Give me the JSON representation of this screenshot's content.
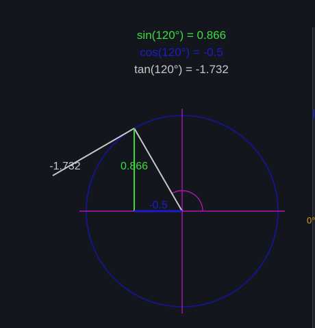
{
  "readouts": {
    "sin": "sin(120°) = 0.866",
    "cos": "cos(120°) = -0.5",
    "tan": "tan(120°) = -1.732"
  },
  "labels": {
    "sin_value": "0.866",
    "cos_value": "-0.5",
    "tan_value": "-1.732",
    "zero_angle": "0°"
  },
  "angle_deg": 120,
  "colors": {
    "background": "#13171d",
    "sin": "#3ddc3d",
    "cos": "#1c1cc8",
    "tan": "#c8c8c8",
    "axes": "#b015b0",
    "circle": "#14149e",
    "angle_marker": "#b015b0",
    "zero_label": "#e0a020"
  }
}
